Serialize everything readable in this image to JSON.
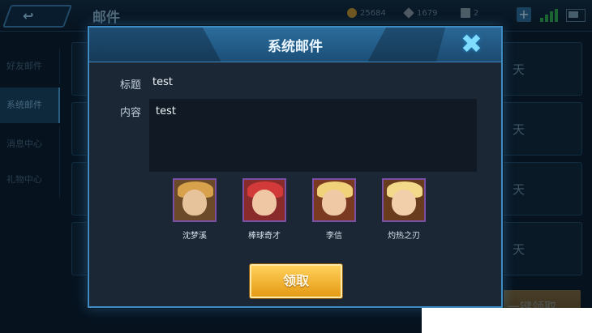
{
  "screen": {
    "title": "邮件",
    "resources": [
      {
        "icon": "gold-coin-icon",
        "value": "25684",
        "color": "#c8952f"
      },
      {
        "icon": "diamond-icon",
        "value": "1679",
        "color": "#8e9aa6"
      },
      {
        "icon": "voucher-icon",
        "value": "2",
        "color": "#8aa0ac"
      }
    ],
    "tabs": [
      "好友邮件",
      "系统邮件",
      "消息中心",
      "礼物中心"
    ],
    "rows": [
      {
        "expiry": "天"
      },
      {
        "expiry": "天"
      },
      {
        "expiry": "天"
      },
      {
        "expiry": "天"
      }
    ],
    "claim_all_label": "一键领取"
  },
  "dialog": {
    "title": "系统邮件",
    "subject_label": "标题",
    "subject_value": "test",
    "content_label": "内容",
    "content_value": "test",
    "rewards": [
      {
        "name": "沈梦溪",
        "border": "#7a4fa3",
        "bg": "#6b4a2a"
      },
      {
        "name": "棒球奇才",
        "border": "#7a4fa3",
        "bg": "#8a2b2b"
      },
      {
        "name": "李信",
        "border": "#7a4fa3",
        "bg": "#7a3a22"
      },
      {
        "name": "灼热之刃",
        "border": "#7a4fa3",
        "bg": "#6a3c1e"
      }
    ],
    "claim_label": "领取"
  }
}
